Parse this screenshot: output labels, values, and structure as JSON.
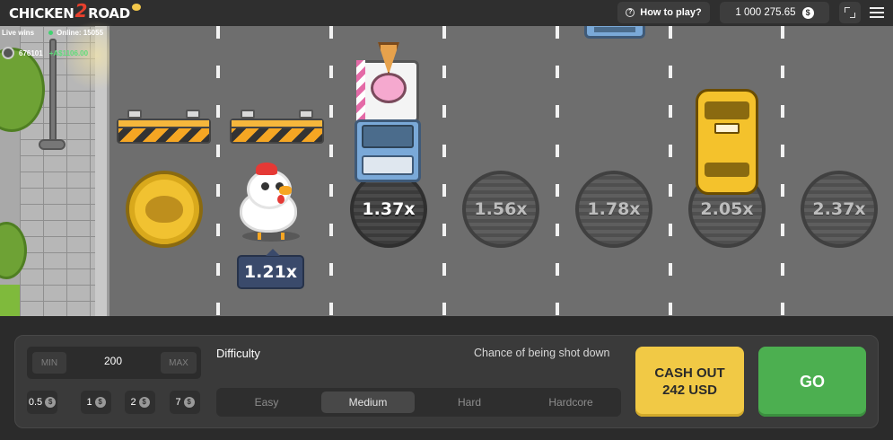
{
  "brand": {
    "logo_part1": "CHICKEN",
    "logo_part2": "2",
    "logo_part3": "ROAD"
  },
  "header": {
    "how_to_play": "How to play?",
    "balance": "1 000 275.65",
    "currency_icon": "$"
  },
  "live": {
    "live_wins_label": "Live wins",
    "online_label": "Online: 15055",
    "winner_id": "676101",
    "winner_amount": "+A$1106.00"
  },
  "lanes": {
    "current_multiplier": "1.21x",
    "multipliers": [
      "1.37x",
      "1.56x",
      "1.78x",
      "2.05x",
      "2.37x"
    ]
  },
  "controls": {
    "min_label": "MIN",
    "max_label": "MAX",
    "bet_value": "200",
    "chips": [
      "0.5",
      "1",
      "2",
      "7"
    ],
    "chip_icon": "$",
    "difficulty_label": "Difficulty",
    "chance_label": "Chance of being shot down",
    "difficulties": [
      "Easy",
      "Medium",
      "Hard",
      "Hardcore"
    ],
    "selected_difficulty": "Medium",
    "cashout_line1": "CASH OUT",
    "cashout_line2": "242 USD",
    "go_label": "GO"
  },
  "colors": {
    "cashout": "#f1c945",
    "go": "#4caf50",
    "online_dot": "#3fd36f",
    "win_amount": "#5fdc7a"
  }
}
